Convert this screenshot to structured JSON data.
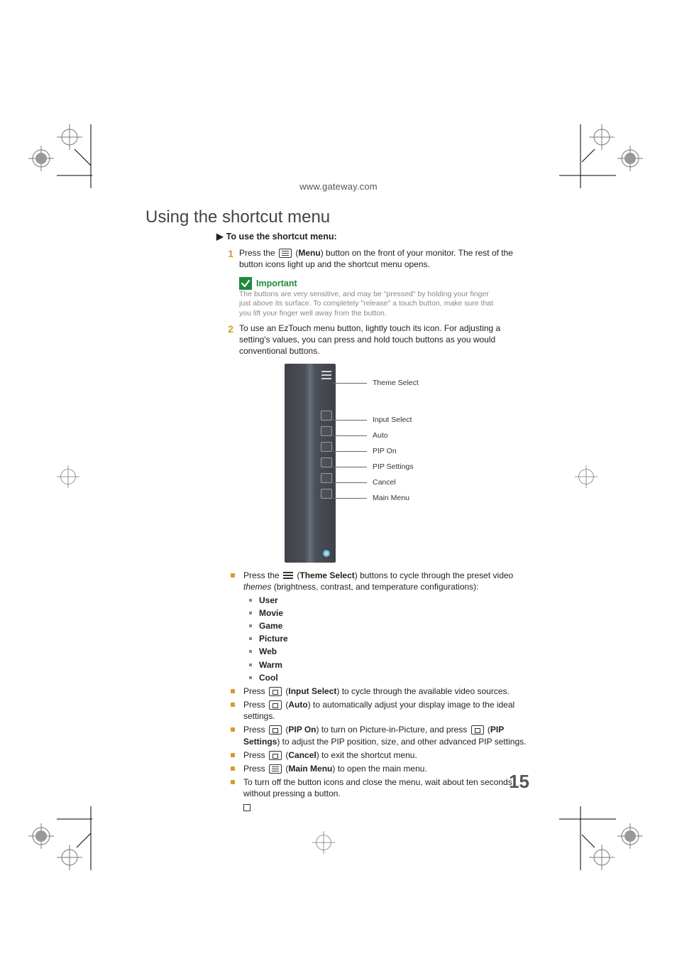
{
  "url": "www.gateway.com",
  "section_title": "Using the shortcut menu",
  "procedure_title": "To use the shortcut menu:",
  "steps": {
    "s1_num": "1",
    "s1_a": "Press the ",
    "s1_b": " (",
    "s1_c": "Menu",
    "s1_d": ") button on the front of your monitor. The rest of the button icons light up and the shortcut menu opens.",
    "s2_num": "2",
    "s2": "To use an EzTouch menu button, lightly touch its icon. For adjusting a setting's values, you can press and hold touch buttons as you would conventional buttons."
  },
  "important": {
    "label": "Important",
    "text": "The buttons are very sensitive, and may be \"pressed\" by holding your finger just above its surface. To completely \"release\" a touch button, make sure that you lift your finger well away from the button."
  },
  "callouts": {
    "theme": "Theme Select",
    "input": "Input Select",
    "auto": "Auto",
    "pip_on": "PIP On",
    "pip_settings": "PIP Settings",
    "cancel": "Cancel",
    "main_menu": "Main Menu"
  },
  "bul": {
    "theme_a": "Press the ",
    "theme_b": " (",
    "theme_c": "Theme Select",
    "theme_d": ") buttons to cycle through the preset video ",
    "theme_e": "themes",
    "theme_f": " (brightness, contrast, and temperature configurations):",
    "themes_list": {
      "u": "User",
      "m": "Movie",
      "g": "Game",
      "p": "Picture",
      "w": "Web",
      "wa": "Warm",
      "c": "Cool"
    },
    "input_a": "Press ",
    "input_b": " (",
    "input_c": "Input Select",
    "input_d": ") to cycle through the available video sources.",
    "auto_a": "Press ",
    "auto_b": " (",
    "auto_c": "Auto",
    "auto_d": ") to automatically adjust your display image to the ideal settings.",
    "pip_a": "Press ",
    "pip_b": " (",
    "pip_c": "PIP On",
    "pip_d": ") to turn on Picture-in-Picture, and press ",
    "pip_e": " (",
    "pip_f": "PIP Settings",
    "pip_g": ") to adjust the PIP position, size, and other advanced PIP settings.",
    "cancel_a": "Press ",
    "cancel_b": " (",
    "cancel_c": "Cancel",
    "cancel_d": ") to exit the shortcut menu.",
    "main_a": "Press ",
    "main_b": " (",
    "main_c": "Main Menu",
    "main_d": ") to open the main menu.",
    "off": "To turn off the button icons and close the menu, wait about ten seconds without pressing a button."
  },
  "page_number": "15"
}
